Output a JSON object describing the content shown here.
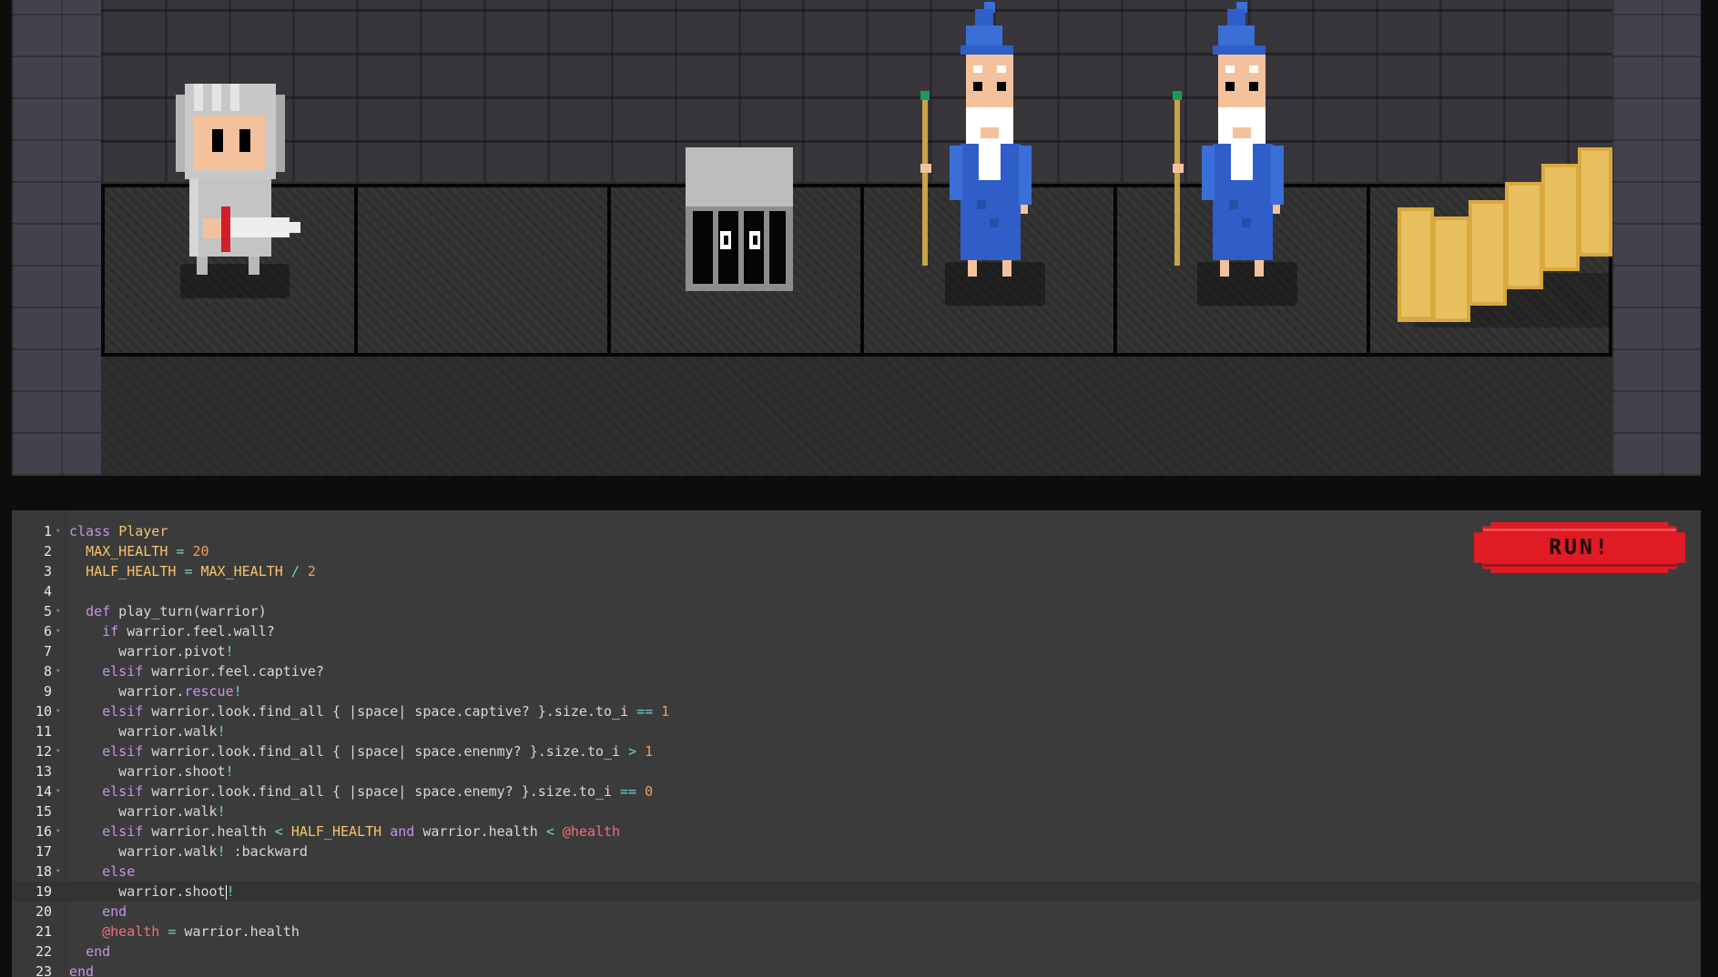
{
  "run_button": {
    "label": "RUN!"
  },
  "scene": {
    "tiles": 6,
    "entities": [
      "warrior",
      "captive",
      "wizard",
      "wizard",
      "stairs"
    ]
  },
  "editor": {
    "active_line": 19,
    "lines": [
      {
        "n": "1",
        "fold": true,
        "code": "class Player"
      },
      {
        "n": "2",
        "fold": false,
        "code": "  MAX_HEALTH = 20"
      },
      {
        "n": "3",
        "fold": false,
        "code": "  HALF_HEALTH = MAX_HEALTH / 2"
      },
      {
        "n": "4",
        "fold": false,
        "code": ""
      },
      {
        "n": "5",
        "fold": true,
        "code": "  def play_turn(warrior)"
      },
      {
        "n": "6",
        "fold": true,
        "code": "    if warrior.feel.wall?"
      },
      {
        "n": "7",
        "fold": false,
        "code": "      warrior.pivot!"
      },
      {
        "n": "8",
        "fold": true,
        "code": "    elsif warrior.feel.captive?"
      },
      {
        "n": "9",
        "fold": false,
        "code": "      warrior.rescue!"
      },
      {
        "n": "10",
        "fold": true,
        "code": "    elsif warrior.look.find_all { |space| space.captive? }.size.to_i == 1"
      },
      {
        "n": "11",
        "fold": false,
        "code": "      warrior.walk!"
      },
      {
        "n": "12",
        "fold": true,
        "code": "    elsif warrior.look.find_all { |space| space.enenmy? }.size.to_i > 1"
      },
      {
        "n": "13",
        "fold": false,
        "code": "      warrior.shoot!"
      },
      {
        "n": "14",
        "fold": true,
        "code": "    elsif warrior.look.find_all { |space| space.enemy? }.size.to_i == 0"
      },
      {
        "n": "15",
        "fold": false,
        "code": "      warrior.walk!"
      },
      {
        "n": "16",
        "fold": true,
        "code": "    elsif warrior.health < HALF_HEALTH and warrior.health < @health"
      },
      {
        "n": "17",
        "fold": false,
        "code": "      warrior.walk! :backward"
      },
      {
        "n": "18",
        "fold": true,
        "code": "    else"
      },
      {
        "n": "19",
        "fold": false,
        "code": "      warrior.shoot!"
      },
      {
        "n": "20",
        "fold": false,
        "code": "    end"
      },
      {
        "n": "21",
        "fold": false,
        "code": "    @health = warrior.health"
      },
      {
        "n": "22",
        "fold": false,
        "code": "  end"
      },
      {
        "n": "23",
        "fold": false,
        "code": "end"
      }
    ]
  },
  "colors": {
    "keyword": "#c792ea",
    "constant": "#f6c46a",
    "number": "#f39c5a",
    "operator": "#6fd0d0",
    "ivar": "#f26d7d",
    "run_button": "#e01b24"
  }
}
